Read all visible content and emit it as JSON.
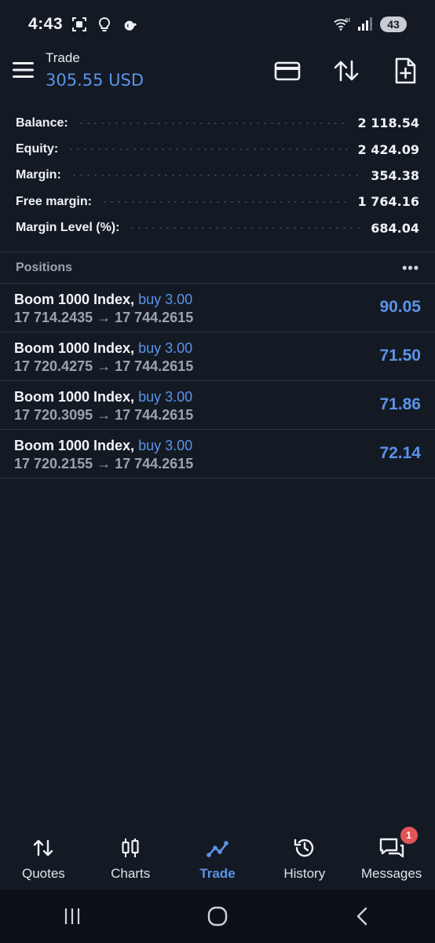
{
  "status_bar": {
    "time": "4:43",
    "network": "6E",
    "battery": "43",
    "icons": [
      "screenshot-icon",
      "bulb-icon",
      "google-icon",
      "wifi-icon",
      "signal-icon"
    ]
  },
  "header": {
    "title": "Trade",
    "balance": "305.55 USD",
    "icons": [
      "menu-icon",
      "card-icon",
      "sort-icon",
      "new-order-icon"
    ]
  },
  "summary": [
    {
      "label": "Balance:",
      "value": "2 118.54"
    },
    {
      "label": "Equity:",
      "value": "2 424.09"
    },
    {
      "label": "Margin:",
      "value": "354.38"
    },
    {
      "label": "Free margin:",
      "value": "1 764.16"
    },
    {
      "label": "Margin Level (%):",
      "value": "684.04"
    }
  ],
  "positions": {
    "header": "Positions",
    "more": "•••",
    "items": [
      {
        "symbol": "Boom 1000 Index,",
        "side": "buy 3.00",
        "prices": "17 714.2435 → 17 744.2615",
        "profit": "90.05"
      },
      {
        "symbol": "Boom 1000 Index,",
        "side": "buy 3.00",
        "prices": "17 720.4275 → 17 744.2615",
        "profit": "71.50"
      },
      {
        "symbol": "Boom 1000 Index,",
        "side": "buy 3.00",
        "prices": "17 720.3095 → 17 744.2615",
        "profit": "71.86"
      },
      {
        "symbol": "Boom 1000 Index,",
        "side": "buy 3.00",
        "prices": "17 720.2155 → 17 744.2615",
        "profit": "72.14"
      }
    ]
  },
  "bottom_nav": [
    {
      "label": "Quotes",
      "icon": "quotes-icon",
      "active": false
    },
    {
      "label": "Charts",
      "icon": "candles-icon",
      "active": false
    },
    {
      "label": "Trade",
      "icon": "trade-icon",
      "active": true
    },
    {
      "label": "History",
      "icon": "history-icon",
      "active": false
    },
    {
      "label": "Messages",
      "icon": "messages-icon",
      "active": false,
      "badge": "1"
    }
  ],
  "colors": {
    "background": "#141a24",
    "accent": "#5b93e8",
    "muted": "#9aa3b0",
    "badge": "#e05656"
  }
}
